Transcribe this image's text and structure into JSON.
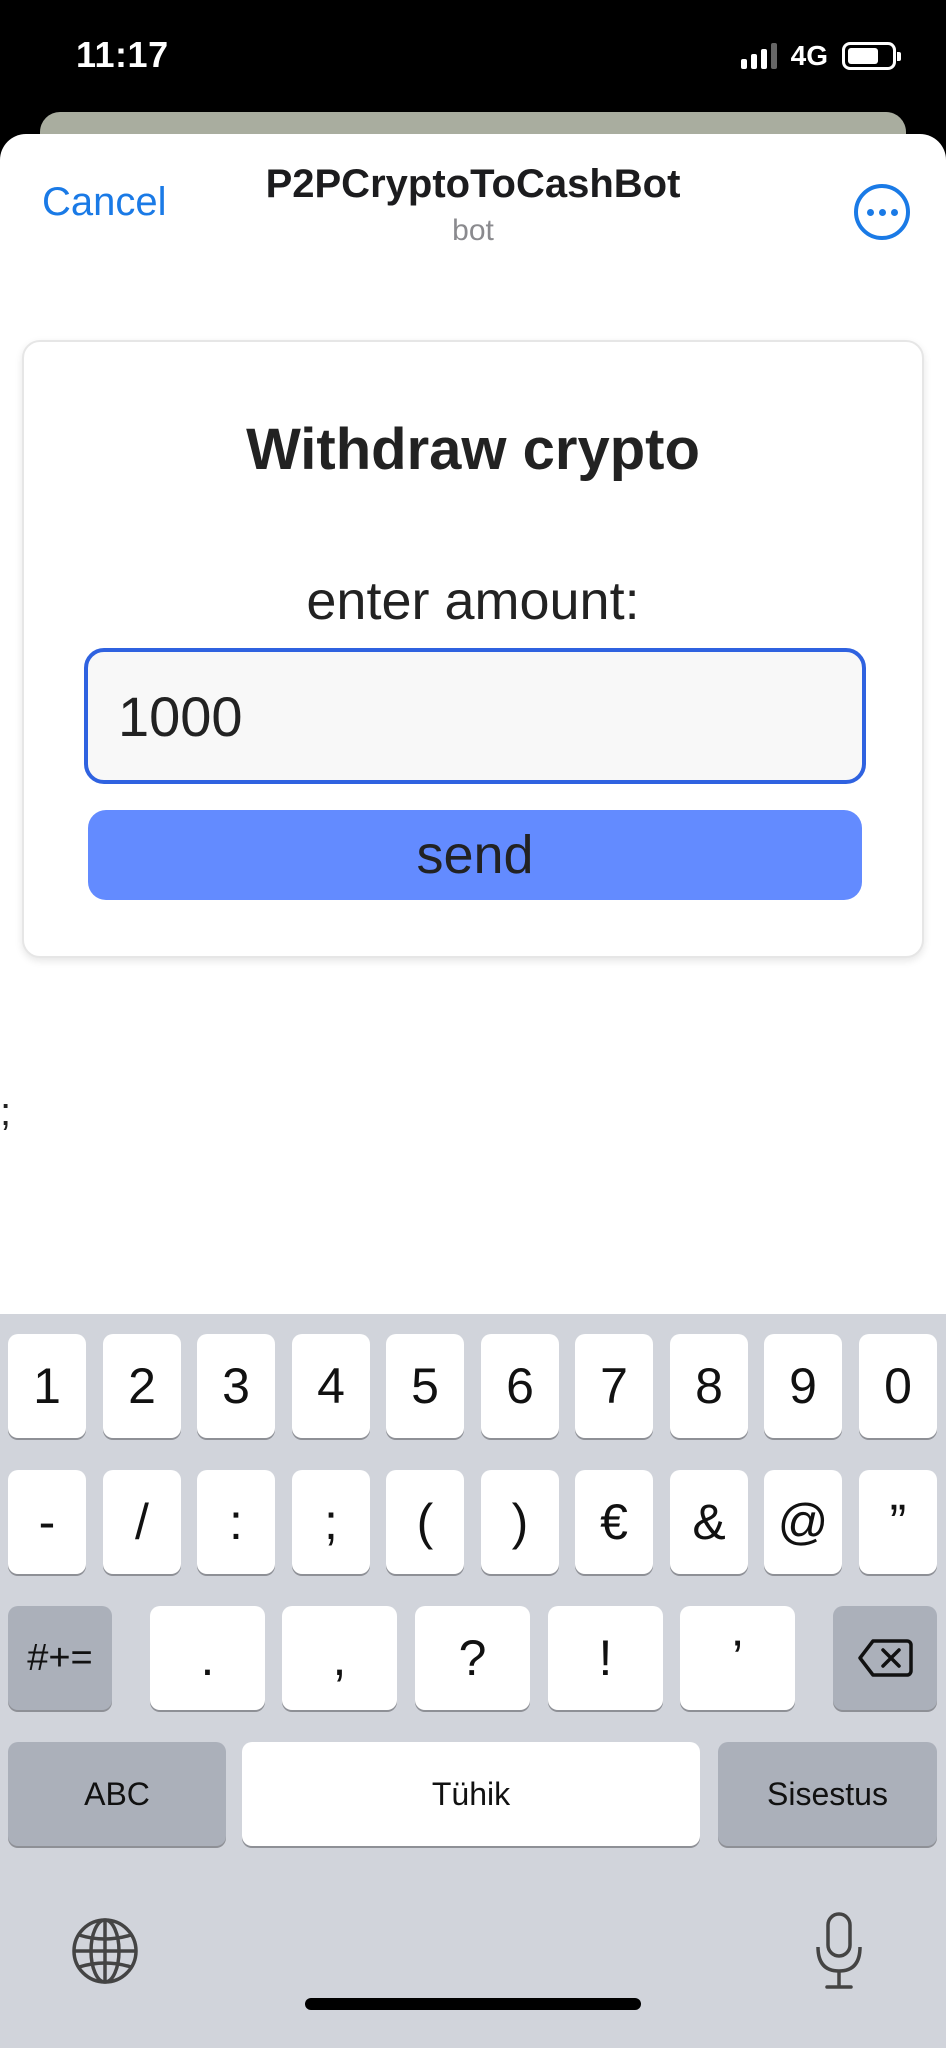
{
  "status_bar": {
    "time": "11:17",
    "network": "4G"
  },
  "nav": {
    "cancel_label": "Cancel",
    "title": "P2PCryptoToCashBot",
    "subtitle": "bot"
  },
  "card": {
    "title": "Withdraw crypto",
    "label": "enter amount:",
    "amount_value": "1000",
    "send_label": "send"
  },
  "stray_text": ";",
  "keyboard": {
    "row1": [
      "1",
      "2",
      "3",
      "4",
      "5",
      "6",
      "7",
      "8",
      "9",
      "0"
    ],
    "row2": [
      "-",
      "/",
      ":",
      ";",
      "(",
      ")",
      "€",
      "&",
      "@",
      "”"
    ],
    "row3_mode": "#+=",
    "row3": [
      ".",
      ",",
      "?",
      "!",
      "’"
    ],
    "abc_label": "ABC",
    "space_label": "Tühik",
    "return_label": "Sisestus"
  },
  "colors": {
    "accent": "#1a7ae6",
    "input_border": "#2f62e0",
    "send_button": "#638bff",
    "keyboard_bg": "#d1d4db"
  },
  "icons": {
    "more": "ellipsis-circle-icon",
    "backspace": "backspace-icon",
    "globe": "globe-icon",
    "mic": "microphone-icon"
  }
}
